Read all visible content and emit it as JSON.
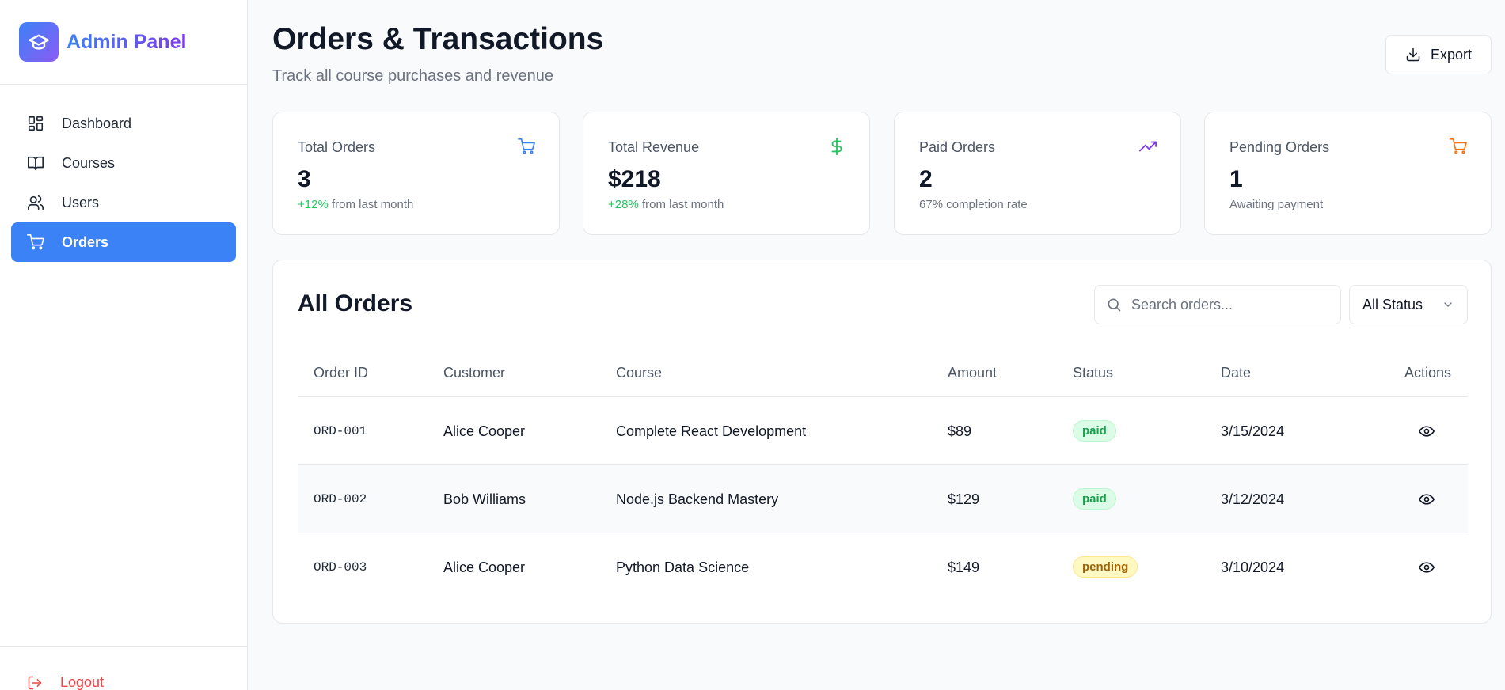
{
  "brand": {
    "title": "Admin Panel",
    "logo_icon": "graduation-cap-icon"
  },
  "sidebar": {
    "items": [
      {
        "label": "Dashboard",
        "icon": "dashboard-grid-icon",
        "active": false
      },
      {
        "label": "Courses",
        "icon": "book-open-icon",
        "active": false
      },
      {
        "label": "Users",
        "icon": "users-icon",
        "active": false
      },
      {
        "label": "Orders",
        "icon": "shopping-cart-icon",
        "active": true
      }
    ],
    "logout_label": "Logout"
  },
  "header": {
    "title": "Orders & Transactions",
    "subtitle": "Track all course purchases and revenue",
    "export_label": "Export"
  },
  "stats": [
    {
      "label": "Total Orders",
      "value": "3",
      "change": "+12%",
      "sub": " from last month",
      "icon": "shopping-cart-icon",
      "icon_color": "#3b82f6"
    },
    {
      "label": "Total Revenue",
      "value": "$218",
      "change": "+28%",
      "sub": " from last month",
      "icon": "dollar-sign-icon",
      "icon_color": "#22c55e"
    },
    {
      "label": "Paid Orders",
      "value": "2",
      "change": "",
      "sub": "67% completion rate",
      "icon": "trending-up-icon",
      "icon_color": "#7c3aed"
    },
    {
      "label": "Pending Orders",
      "value": "1",
      "change": "",
      "sub": "Awaiting payment",
      "icon": "shopping-cart-icon",
      "icon_color": "#f97316"
    }
  ],
  "orders": {
    "title": "All Orders",
    "search_placeholder": "Search orders...",
    "status_filter": "All Status",
    "columns": [
      "Order ID",
      "Customer",
      "Course",
      "Amount",
      "Status",
      "Date",
      "Actions"
    ],
    "rows": [
      {
        "id": "ORD-001",
        "customer": "Alice Cooper",
        "course": "Complete React Development",
        "amount": "$89",
        "status": "paid",
        "date": "3/15/2024"
      },
      {
        "id": "ORD-002",
        "customer": "Bob Williams",
        "course": "Node.js Backend Mastery",
        "amount": "$129",
        "status": "paid",
        "date": "3/12/2024"
      },
      {
        "id": "ORD-003",
        "customer": "Alice Cooper",
        "course": "Python Data Science",
        "amount": "$149",
        "status": "pending",
        "date": "3/10/2024"
      }
    ]
  },
  "colors": {
    "accent": "#3b82f6",
    "paid": "#16a34a",
    "pending": "#a16207",
    "logout": "#ef4444"
  }
}
